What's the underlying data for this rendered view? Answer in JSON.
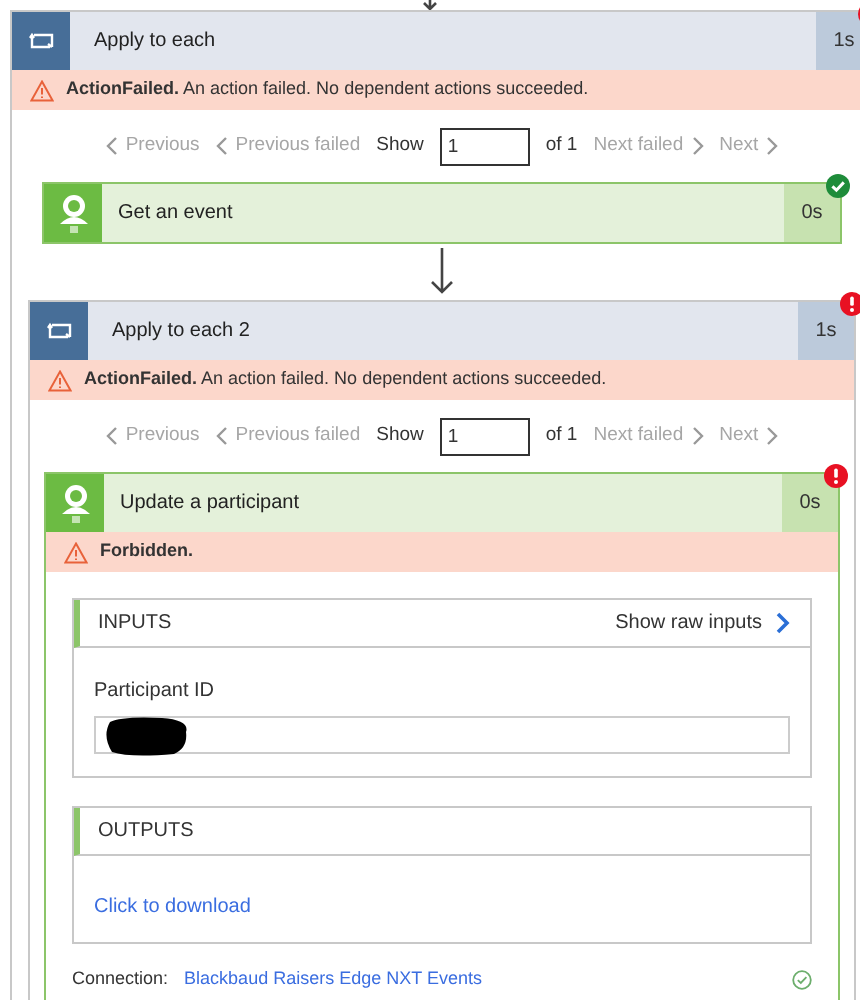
{
  "run": {
    "kind": "loop",
    "title": "Apply to each",
    "duration": "1s",
    "failed": true,
    "error": {
      "code": "ActionFailed.",
      "message": "An action failed. No dependent actions succeeded."
    },
    "pager": {
      "previous": {
        "label": "Previous",
        "disabled": true
      },
      "previous_failed": {
        "label": "Previous failed",
        "disabled": true
      },
      "show_label": "Show",
      "index": "1",
      "of_label": "of 1",
      "next_failed": {
        "label": "Next failed",
        "disabled": true
      },
      "next": {
        "label": "Next",
        "disabled": true
      }
    },
    "children": [
      {
        "kind": "action",
        "title": "Get an event",
        "duration": "0s",
        "failed": false
      },
      {
        "kind": "loop",
        "title": "Apply to each 2",
        "duration": "1s",
        "failed": true,
        "error": {
          "code": "ActionFailed.",
          "message": "An action failed. No dependent actions succeeded."
        },
        "pager": {
          "previous": {
            "label": "Previous",
            "disabled": true
          },
          "previous_failed": {
            "label": "Previous failed",
            "disabled": true
          },
          "show_label": "Show",
          "index": "1",
          "of_label": "of 1",
          "next_failed": {
            "label": "Next failed",
            "disabled": true
          },
          "next": {
            "label": "Next",
            "disabled": true
          }
        },
        "children": [
          {
            "kind": "action",
            "title": "Update a participant",
            "duration": "0s",
            "failed": true,
            "error": {
              "code": "Forbidden."
            },
            "inputs": {
              "title": "INPUTS",
              "raw_link": "Show raw inputs",
              "fields": [
                {
                  "label": "Participant ID",
                  "redacted": true
                }
              ]
            },
            "outputs": {
              "title": "OUTPUTS",
              "download_link": "Click to download"
            },
            "connection": {
              "label": "Connection:",
              "name": "Blackbaud Raisers Edge NXT Events",
              "verified": true
            }
          }
        ]
      }
    ]
  }
}
